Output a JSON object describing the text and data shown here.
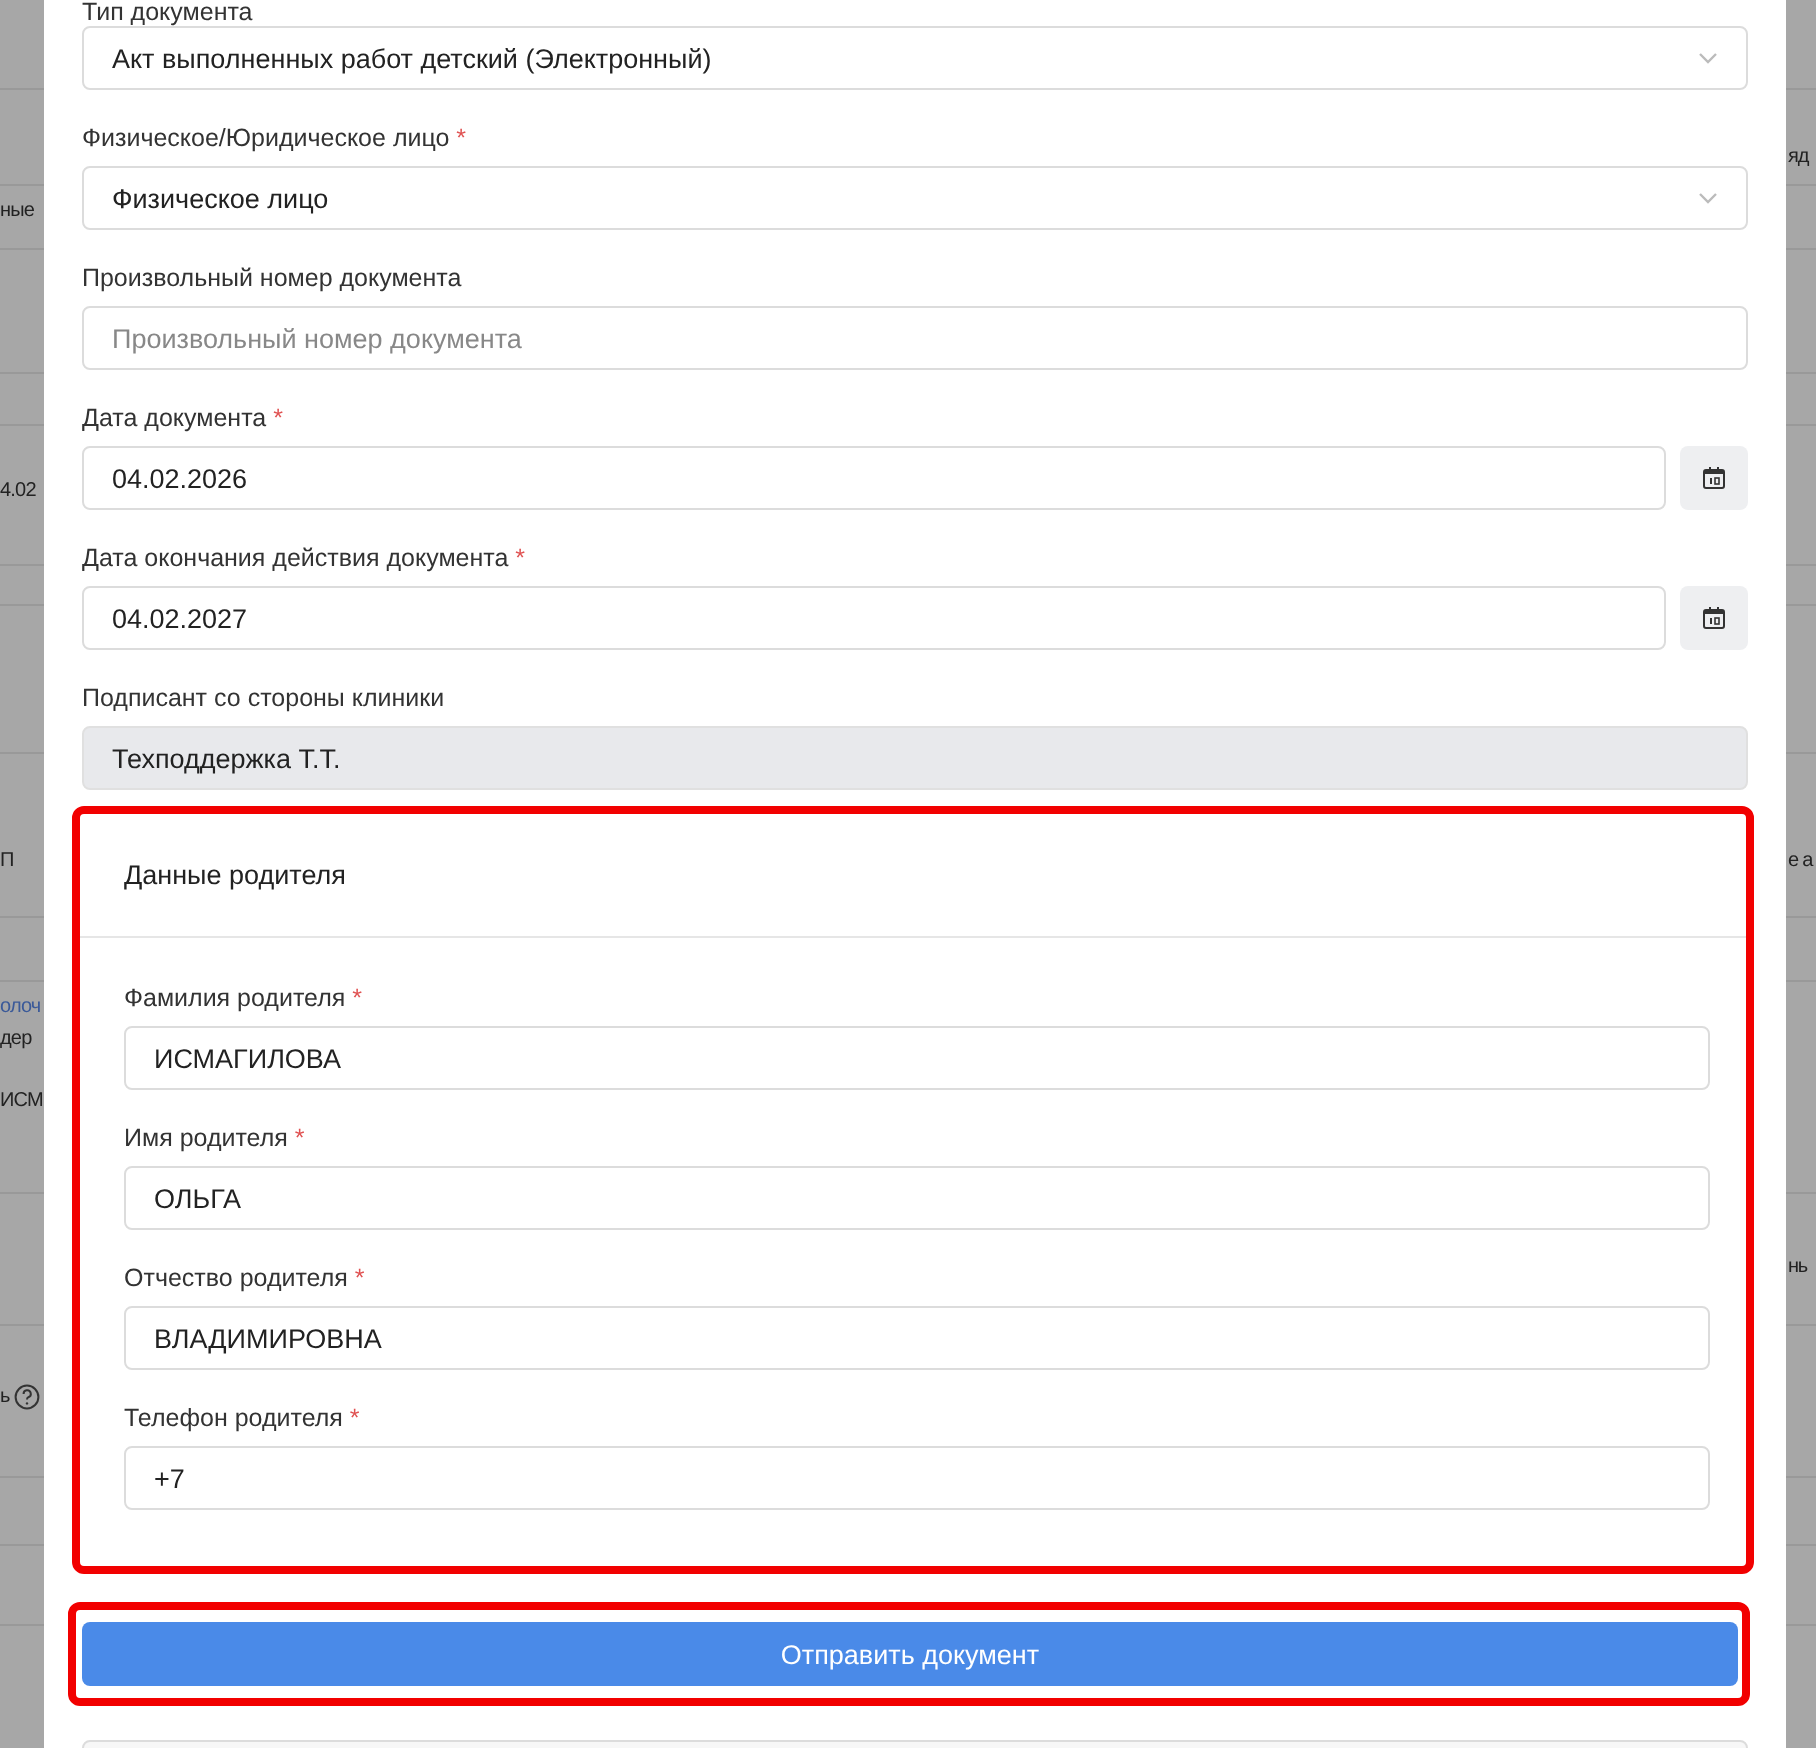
{
  "left_edge_fragments": [
    {
      "text": "ные",
      "kind": "text"
    },
    {
      "text": "4.02",
      "kind": "text"
    },
    {
      "text": "П",
      "kind": "text"
    },
    {
      "text": "олоч",
      "kind": "link"
    },
    {
      "text": "дер",
      "kind": "text"
    },
    {
      "text": "ИСМ",
      "kind": "text"
    },
    {
      "text": "ь",
      "kind": "help"
    }
  ],
  "right_edge_fragments": [
    {
      "text": "яд"
    },
    {
      "text": "е а"
    },
    {
      "text": "нь"
    }
  ],
  "required_mark": "*",
  "form": {
    "fields": [
      {
        "label": "Тип документа",
        "required": false,
        "kind": "select",
        "value": "Акт выполненных работ детский (Электронный)"
      },
      {
        "label": "Физическое/Юридическое лицо",
        "required": true,
        "kind": "select",
        "value": "Физическое лицо"
      },
      {
        "label": "Произвольный номер документа",
        "required": false,
        "kind": "text",
        "placeholder": "Произвольный номер документа"
      },
      {
        "label": "Дата документа",
        "required": true,
        "kind": "date",
        "value": "04.02.2026"
      },
      {
        "label": "Дата окончания действия документа",
        "required": true,
        "kind": "date",
        "value": "04.02.2027"
      },
      {
        "label": "Подписант со стороны клиники",
        "required": false,
        "kind": "readonly",
        "value": "Техподдержка Т.Т."
      }
    ]
  },
  "parent_section": {
    "title": "Данные родителя",
    "highlighted": true,
    "fields": [
      {
        "label": "Фамилия родителя",
        "required": true,
        "kind": "text",
        "value": "ИСМАГИЛОВА"
      },
      {
        "label": "Имя родителя",
        "required": true,
        "kind": "text",
        "value": "ОЛЬГА"
      },
      {
        "label": "Отчество родителя",
        "required": true,
        "kind": "text",
        "value": "ВЛАДИМИРОВНА"
      },
      {
        "label": "Телефон родителя",
        "required": true,
        "kind": "text",
        "value": "+7"
      }
    ]
  },
  "submit_button": {
    "label": "Отправить документ",
    "highlighted": true
  }
}
